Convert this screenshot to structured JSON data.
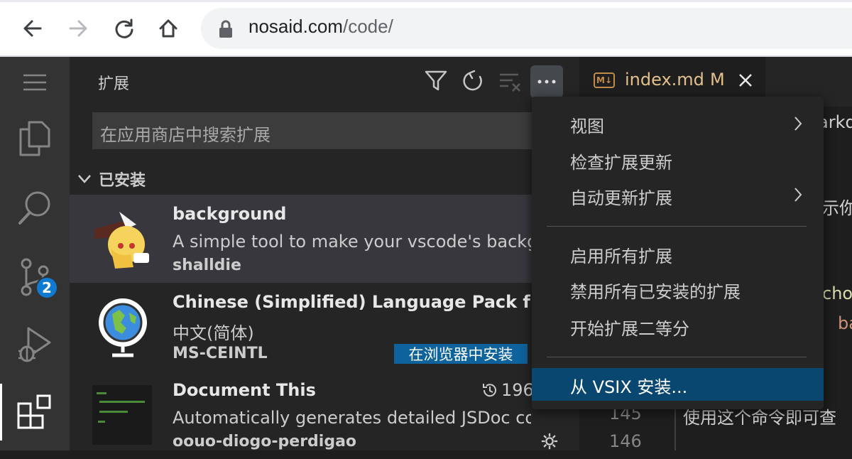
{
  "browser": {
    "url_host": "nosaid.com",
    "url_path": "/code/"
  },
  "sidebar": {
    "title": "扩展",
    "search_placeholder": "在应用商店中搜索扩展",
    "section_label": "已安装",
    "source_control_badge": "2",
    "extensions": [
      {
        "name": "background",
        "description": "A simple tool to make your vscode's background",
        "publisher": "shalldie"
      },
      {
        "name": "Chinese (Simplified) Language Pack for Visual Studio Code",
        "description": "中文(简体)",
        "publisher": "MS-CEINTL",
        "action": "在浏览器中安装"
      },
      {
        "name": "Document This",
        "description": "Automatically generates detailed JSDoc comments",
        "publisher": "oouo-diogo-perdigao",
        "installs": "196"
      }
    ]
  },
  "editor": {
    "tab_name": "index.md",
    "tab_status": "M",
    "tab_icon": "M↓",
    "fragments": [
      "arkd",
      "示你",
      "cho",
      "ba",
      "使用这个命令即可查"
    ],
    "line_numbers": [
      "145",
      "146"
    ]
  },
  "menu": {
    "items": [
      {
        "label": "视图",
        "submenu": true
      },
      {
        "label": "检查扩展更新",
        "submenu": false
      },
      {
        "label": "自动更新扩展",
        "submenu": true
      },
      {
        "label": "启用所有扩展",
        "submenu": false
      },
      {
        "label": "禁用所有已安装的扩展",
        "submenu": false
      },
      {
        "label": "开始扩展二等分",
        "submenu": false
      },
      {
        "label": "从 VSIX 安装...",
        "submenu": false
      }
    ]
  },
  "colors": {
    "activity_bar": "#333333",
    "sidebar": "#252526",
    "editor": "#1e1e1e",
    "menu_selection": "#094771",
    "install_button": "#0e639c",
    "badge": "#0e7ad1",
    "modified_tab": "#e2c08d"
  }
}
